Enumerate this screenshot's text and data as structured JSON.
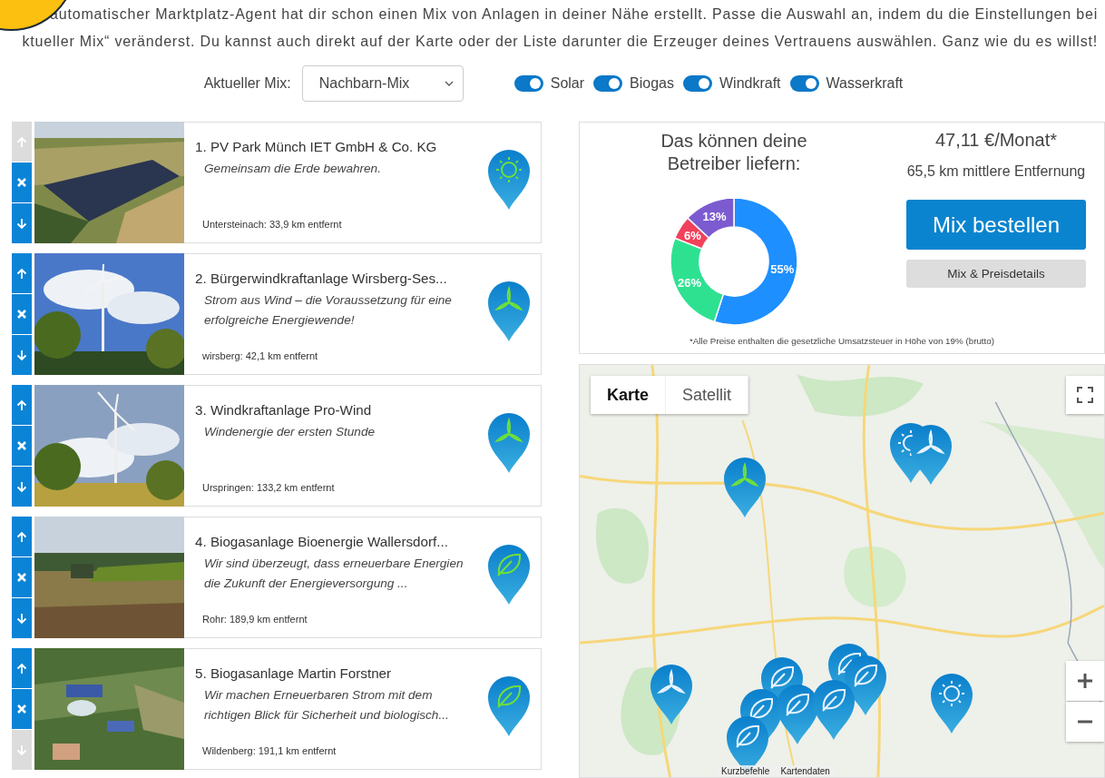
{
  "intro": [
    "automatischer Marktplatz-Agent hat dir schon einen Mix von Anlagen in deiner Nähe erstellt. Passe die Auswahl an, indem du die Einstellungen bei",
    "ktueller Mix“ veränderst. Du kannst auch direkt auf der Karte oder der Liste darunter die Erzeuger deines Vertrauens auswählen. Ganz wie du es willst!"
  ],
  "mix_select": {
    "label": "Aktueller Mix:",
    "value": "Nachbarn-Mix"
  },
  "toggles": [
    {
      "label": "Solar",
      "on": true
    },
    {
      "label": "Biogas",
      "on": true
    },
    {
      "label": "Windkraft",
      "on": true
    },
    {
      "label": "Wasserkraft",
      "on": true
    }
  ],
  "plants": [
    {
      "title": "1. PV Park Münch IET GmbH & Co. KG",
      "slogan": "Gemeinsam die Erde bewahren.",
      "distance": "Untersteinach: 33,9 km entfernt",
      "kind": "solar",
      "up_disabled": true,
      "down_disabled": false
    },
    {
      "title": "2. Bürgerwindkraftanlage Wirsberg-Ses...",
      "slogan": "Strom aus Wind – die Voraussetzung für eine erfolgreiche Energiewende!",
      "distance": "wirsberg: 42,1 km entfernt",
      "kind": "wind",
      "up_disabled": false,
      "down_disabled": false
    },
    {
      "title": "3. Windkraftanlage Pro-Wind",
      "slogan": "Windenergie der ersten Stunde",
      "distance": "Urspringen: 133,2 km entfernt",
      "kind": "wind",
      "up_disabled": false,
      "down_disabled": false
    },
    {
      "title": "4. Biogasanlage Bioenergie Wallersdorf...",
      "slogan": "Wir sind überzeugt, dass erneuerbare Energien die Zukunft der Energieversorgung ...",
      "distance": "Rohr: 189,9 km entfernt",
      "kind": "biogas",
      "up_disabled": false,
      "down_disabled": false
    },
    {
      "title": "5. Biogasanlage Martin Forstner",
      "slogan": "Wir machen Erneuerbaren Strom mit dem richtigen Blick für Sicherheit und biologisch...",
      "distance": "Wildenberg: 191,1 km entfernt",
      "kind": "biogas",
      "up_disabled": false,
      "down_disabled": true
    }
  ],
  "summary": {
    "heading": "Das können deine Betreiber liefern:",
    "price": "47,11 €/Monat*",
    "distance": "65,5 km mittlere Entfernung",
    "order_button": "Mix bestellen",
    "details_button": "Mix & Preisdetails",
    "footnote": "*Alle Preise enthalten die gesetzliche Umsatzsteuer in Höhe von 19% (brutto)",
    "chart_data": {
      "type": "donut",
      "values": [
        55,
        26,
        6,
        13
      ],
      "colors": [
        "#1e8fff",
        "#2ee191",
        "#f2415b",
        "#7c5bd0"
      ],
      "value_labels": [
        "55%",
        "26%",
        "6%",
        "13%"
      ]
    }
  },
  "map": {
    "tabs": [
      {
        "label": "Karte",
        "selected": true
      },
      {
        "label": "Satellit",
        "selected": false
      }
    ],
    "attribution": [
      "Kurzbefehle",
      "Kartendaten"
    ],
    "markers": [
      {
        "kind": "wind"
      },
      {
        "kind": "solar"
      },
      {
        "kind": "wind"
      },
      {
        "kind": "solar"
      },
      {
        "kind": "wind"
      },
      {
        "kind": "biogas"
      },
      {
        "kind": "biogas"
      },
      {
        "kind": "biogas"
      },
      {
        "kind": "biogas"
      },
      {
        "kind": "biogas"
      },
      {
        "kind": "biogas"
      },
      {
        "kind": "biogas"
      }
    ]
  }
}
